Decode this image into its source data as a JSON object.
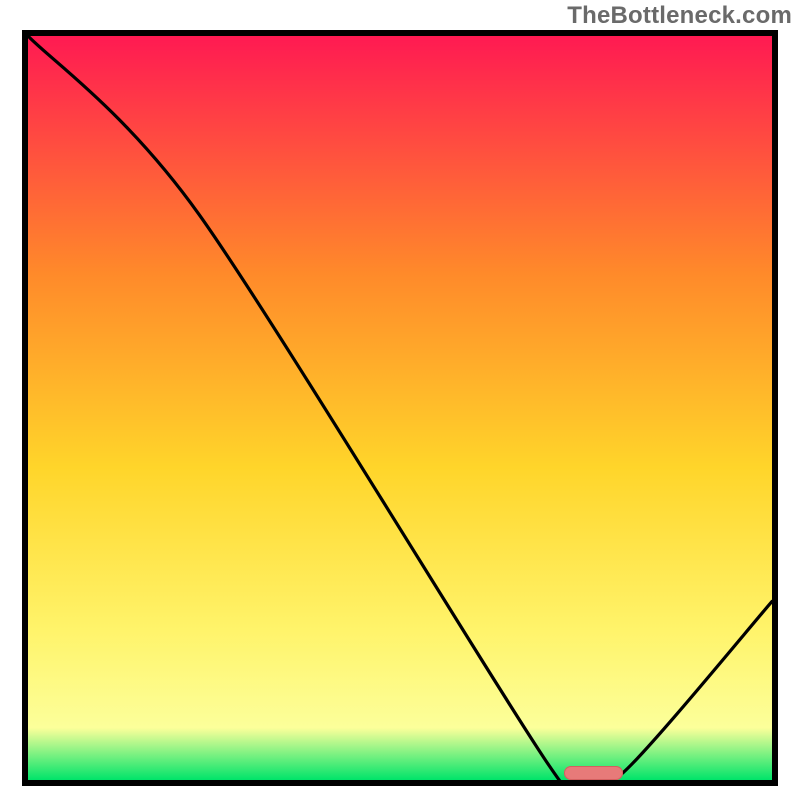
{
  "watermark": "TheBottleneck.com",
  "colors": {
    "frame_border": "#000000",
    "gradient_top": "#ff1a52",
    "gradient_upper_mid": "#ff8a2a",
    "gradient_mid": "#ffd52a",
    "gradient_lower_mid": "#fff46b",
    "gradient_near_bottom": "#fcff9a",
    "gradient_bottom": "#00e46a",
    "curve": "#000000",
    "marker_fill": "#e77a79",
    "marker_stroke": "#d35f5f"
  },
  "chart_data": {
    "type": "line",
    "title": "",
    "xlabel": "",
    "ylabel": "",
    "xlim": [
      0,
      100
    ],
    "ylim": [
      0,
      100
    ],
    "x": [
      0,
      23,
      70,
      74,
      80,
      100
    ],
    "values": [
      100,
      76,
      2,
      1,
      1,
      24
    ],
    "marker": {
      "x_start": 72,
      "x_end": 80,
      "y": 1
    },
    "notes": "Curve starts at top-left, descends with a slope change near x≈23, reaches a flat minimum around x≈72–80, then rises toward the right edge. Background is a vertical red→orange→yellow→green gradient. A small rounded salmon marker sits at the curve minimum."
  }
}
